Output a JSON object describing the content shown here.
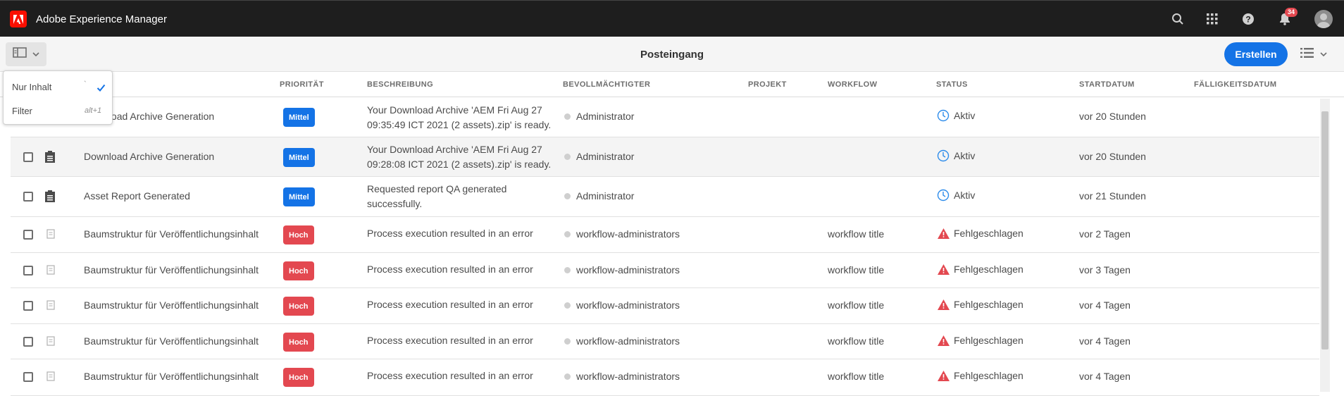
{
  "shell": {
    "title": "Adobe Experience Manager",
    "notification_count": "34",
    "icons": [
      "search-icon",
      "apps-grid-icon",
      "help-icon",
      "bell-icon",
      "user-avatar"
    ]
  },
  "actionbar": {
    "title": "Posteingang",
    "create_label": "Erstellen"
  },
  "rail_menu": {
    "items": [
      {
        "label": "Nur Inhalt",
        "shortcut": "`",
        "checked": true
      },
      {
        "label": "Filter",
        "shortcut": "alt+1",
        "checked": false
      }
    ]
  },
  "table": {
    "columns": [
      "PRIORITÄT",
      "BESCHREIBUNG",
      "BEVOLLMÄCHTIGTER",
      "PROJEKT",
      "WORKFLOW",
      "STATUS",
      "STARTDATUM",
      "FÄLLIGKEITSDATUM"
    ],
    "rows": [
      {
        "title": "Download Archive Generation",
        "priority": "Mittel",
        "desc1": "Your Download Archive 'AEM Fri Aug 27",
        "desc2": "09:35:49 ICT 2021 (2 assets).zip' is ready.",
        "assignee": "Administrator",
        "workflow": "",
        "status": "Aktiv",
        "start": "vor 20 Stunden"
      },
      {
        "title": "Download Archive Generation",
        "priority": "Mittel",
        "desc1": "Your Download Archive 'AEM Fri Aug 27",
        "desc2": "09:28:08 ICT 2021 (2 assets).zip' is ready.",
        "assignee": "Administrator",
        "workflow": "",
        "status": "Aktiv",
        "start": "vor 20 Stunden"
      },
      {
        "title": "Asset Report Generated",
        "priority": "Mittel",
        "desc1": "Requested report QA generated",
        "desc2": "successfully.",
        "assignee": "Administrator",
        "workflow": "",
        "status": "Aktiv",
        "start": "vor 21 Stunden"
      },
      {
        "title": "Baumstruktur für Veröffentlichungsinhalt",
        "priority": "Hoch",
        "desc1": "Process execution resulted in an error",
        "desc2": "",
        "assignee": "workflow-administrators",
        "workflow": "workflow title",
        "status": "Fehlgeschlagen",
        "start": "vor 2 Tagen"
      },
      {
        "title": "Baumstruktur für Veröffentlichungsinhalt",
        "priority": "Hoch",
        "desc1": "Process execution resulted in an error",
        "desc2": "",
        "assignee": "workflow-administrators",
        "workflow": "workflow title",
        "status": "Fehlgeschlagen",
        "start": "vor 3 Tagen"
      },
      {
        "title": "Baumstruktur für Veröffentlichungsinhalt",
        "priority": "Hoch",
        "desc1": "Process execution resulted in an error",
        "desc2": "",
        "assignee": "workflow-administrators",
        "workflow": "workflow title",
        "status": "Fehlgeschlagen",
        "start": "vor 4 Tagen"
      },
      {
        "title": "Baumstruktur für Veröffentlichungsinhalt",
        "priority": "Hoch",
        "desc1": "Process execution resulted in an error",
        "desc2": "",
        "assignee": "workflow-administrators",
        "workflow": "workflow title",
        "status": "Fehlgeschlagen",
        "start": "vor 4 Tagen"
      },
      {
        "title": "Baumstruktur für Veröffentlichungsinhalt",
        "priority": "Hoch",
        "desc1": "Process execution resulted in an error",
        "desc2": "",
        "assignee": "workflow-administrators",
        "workflow": "workflow title",
        "status": "Fehlgeschlagen",
        "start": "vor 4 Tagen"
      }
    ]
  },
  "colors": {
    "accent": "#1473e6",
    "error": "#e34850",
    "shell": "#1e1e1e"
  }
}
